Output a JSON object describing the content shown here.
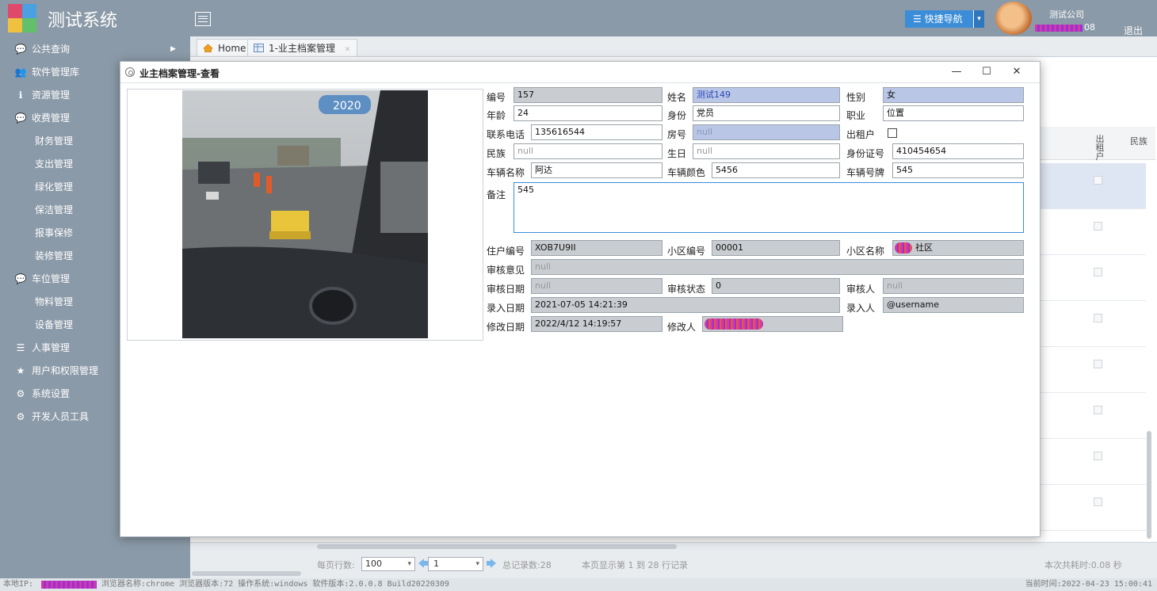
{
  "header": {
    "app_title": "测试系统",
    "quicknav_label": "☰ 快捷导航",
    "company": "测试公司",
    "user_suffix": "08",
    "logout_label": "退出"
  },
  "sidebar": {
    "items": [
      {
        "label": "公共查询",
        "icon": "chat-icon",
        "glyph": "💬",
        "arrow": "▶"
      },
      {
        "label": "软件管理库",
        "icon": "users-icon",
        "glyph": "👥"
      },
      {
        "label": "资源管理",
        "icon": "info-icon",
        "glyph": "ℹ"
      },
      {
        "label": "收费管理",
        "icon": "chat-icon",
        "glyph": "💬"
      },
      {
        "label": "财务管理",
        "sub": true
      },
      {
        "label": "支出管理",
        "sub": true
      },
      {
        "label": "绿化管理",
        "sub": true
      },
      {
        "label": "保洁管理",
        "sub": true
      },
      {
        "label": "报事保修",
        "sub": true
      },
      {
        "label": "装修管理",
        "sub": true
      },
      {
        "label": "车位管理",
        "icon": "chat-icon",
        "glyph": "💬"
      },
      {
        "label": "物料管理",
        "sub": true
      },
      {
        "label": "设备管理",
        "sub": true
      },
      {
        "label": "人事管理",
        "icon": "list-icon",
        "glyph": "☰"
      },
      {
        "label": "用户和权限管理",
        "icon": "star-icon",
        "glyph": "★"
      },
      {
        "label": "系统设置",
        "icon": "gear-icon",
        "glyph": "⚙"
      },
      {
        "label": "开发人员工具",
        "icon": "gears-icon",
        "glyph": "⚙"
      }
    ]
  },
  "tabs": [
    {
      "label": "Home",
      "icon": "home-icon"
    },
    {
      "label": "1-业主档案管理",
      "icon": "table-icon",
      "closable": true
    }
  ],
  "background_grid": {
    "columns": [
      "出租户",
      "民族"
    ]
  },
  "dialog": {
    "title": "业主档案管理-查看",
    "controls": {
      "minimize": "—",
      "maximize": "☐",
      "close": "✕"
    },
    "fields": {
      "id": {
        "label": "编号",
        "value": "157"
      },
      "name": {
        "label": "姓名",
        "value": "测试149"
      },
      "gender": {
        "label": "性别",
        "value": "女"
      },
      "age": {
        "label": "年龄",
        "value": "24"
      },
      "identity": {
        "label": "身份",
        "value": "党员"
      },
      "job": {
        "label": "职业",
        "value": "位置"
      },
      "phone": {
        "label": "联系电话",
        "value": "135616544"
      },
      "room": {
        "label": "房号",
        "value": "null"
      },
      "renter": {
        "label": "出租户",
        "checked": false
      },
      "nation": {
        "label": "民族",
        "value": "null"
      },
      "birthday": {
        "label": "生日",
        "value": "null"
      },
      "idcard": {
        "label": "身份证号",
        "value": "410454654"
      },
      "car_name": {
        "label": "车辆名称",
        "value": "阿达"
      },
      "car_color": {
        "label": "车辆颜色",
        "value": "5456"
      },
      "car_plate": {
        "label": "车辆号牌",
        "value": "545"
      },
      "remark": {
        "label": "备注",
        "value": "545"
      },
      "household_no": {
        "label": "住户编号",
        "value": "XOB7U9II"
      },
      "community_no": {
        "label": "小区编号",
        "value": "00001"
      },
      "community_name": {
        "label": "小区名称",
        "value": "社区"
      },
      "review_opinion": {
        "label": "审核意见",
        "value": "null"
      },
      "review_date": {
        "label": "审核日期",
        "value": "null"
      },
      "review_status": {
        "label": "审核状态",
        "value": "0"
      },
      "reviewer": {
        "label": "审核人",
        "value": "null"
      },
      "entry_date": {
        "label": "录入日期",
        "value": "2021-07-05 14:21:39"
      },
      "entry_user": {
        "label": "录入人",
        "value": "@username"
      },
      "modify_date": {
        "label": "修改日期",
        "value": "2022/4/12 14:19:57"
      },
      "modifier": {
        "label": "修改人",
        "value": ""
      }
    }
  },
  "pager": {
    "rows_label": "每页行数:",
    "rows_value": "100",
    "page_value": "1",
    "total": "总记录数:28",
    "range": "本页显示第 1 到 28 行记录",
    "time": "本次共耗时:0.08 秒"
  },
  "status": {
    "left_prefix": "本地IP:",
    "left_rest": "浏览器名称:chrome 浏览器版本:72 操作系统:windows 软件版本:2.0.0.8 Build20220309",
    "right": "当前时间:2022-04-23 15:00:41"
  },
  "colors": {
    "chrome": "#8b9aa8",
    "accent": "#3c8dd8",
    "readonly": "#c9cdd1",
    "highlight": "#b9c6e6"
  }
}
